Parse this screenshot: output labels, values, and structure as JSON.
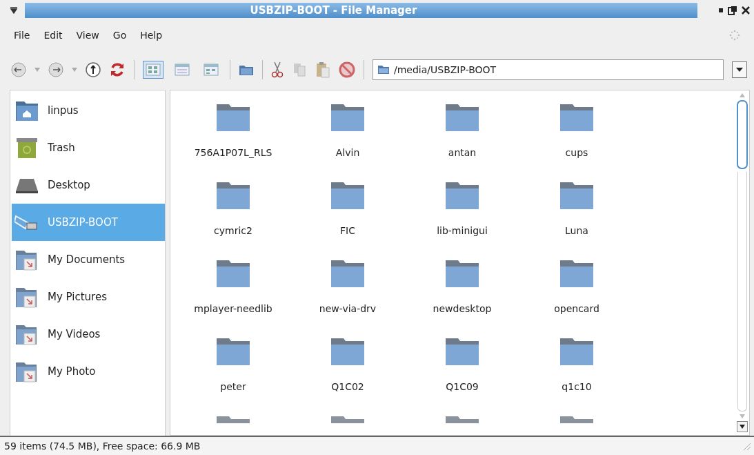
{
  "window": {
    "title": "USBZIP-BOOT - File Manager"
  },
  "menu": [
    {
      "label": "File"
    },
    {
      "label": "Edit"
    },
    {
      "label": "View"
    },
    {
      "label": "Go"
    },
    {
      "label": "Help"
    }
  ],
  "toolbar": {
    "views": [
      {
        "kind": "icons",
        "selected": true
      },
      {
        "kind": "details",
        "selected": false
      },
      {
        "kind": "compact",
        "selected": false
      }
    ],
    "location": "/media/USBZIP-BOOT"
  },
  "sidebar": {
    "items": [
      {
        "label": "linpus",
        "kind": "home",
        "selected": false
      },
      {
        "label": "Trash",
        "kind": "trash",
        "selected": false
      },
      {
        "label": "Desktop",
        "kind": "desktop",
        "selected": false
      },
      {
        "label": "USBZIP-BOOT",
        "kind": "usb",
        "selected": true
      },
      {
        "label": "My Documents",
        "kind": "link",
        "selected": false
      },
      {
        "label": "My Pictures",
        "kind": "link",
        "selected": false
      },
      {
        "label": "My Videos",
        "kind": "link",
        "selected": false
      },
      {
        "label": "My Photo",
        "kind": "link",
        "selected": false
      }
    ]
  },
  "folders": [
    {
      "name": "756A1P07L_RLS"
    },
    {
      "name": "Alvin"
    },
    {
      "name": "antan"
    },
    {
      "name": "cups"
    },
    {
      "name": "cymric2"
    },
    {
      "name": "FIC"
    },
    {
      "name": "lib-minigui"
    },
    {
      "name": "Luna"
    },
    {
      "name": "mplayer-needlib"
    },
    {
      "name": "new-via-drv"
    },
    {
      "name": "newdesktop"
    },
    {
      "name": "opencard"
    },
    {
      "name": "peter"
    },
    {
      "name": "Q1C02"
    },
    {
      "name": "Q1C09"
    },
    {
      "name": "q1c10"
    },
    {
      "kind": "cut"
    },
    {
      "kind": "cut"
    },
    {
      "kind": "cut"
    },
    {
      "kind": "cut"
    }
  ],
  "status_bar": {
    "text": "59 items (74.5 MB), Free space: 66.9 MB"
  }
}
